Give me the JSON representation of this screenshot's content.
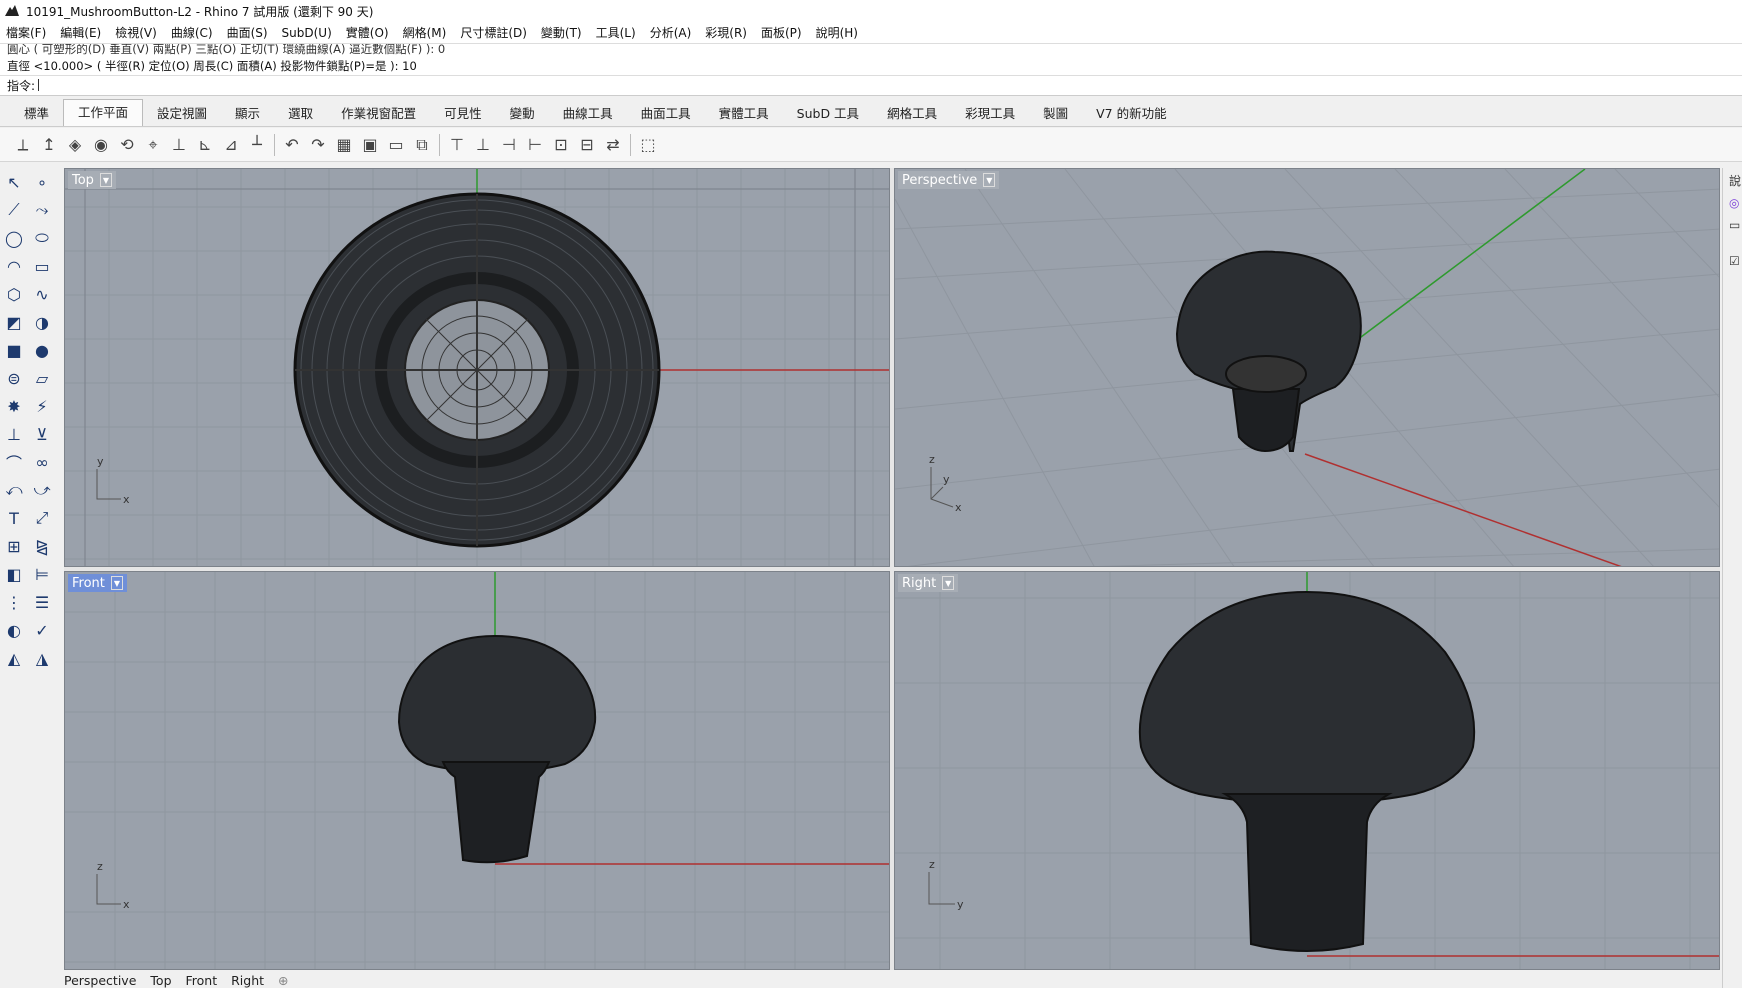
{
  "window": {
    "title": "10191_MushroomButton-L2 - Rhino 7 試用版 (還剩下 90 天)"
  },
  "menu": [
    "檔案(F)",
    "編輯(E)",
    "檢視(V)",
    "曲線(C)",
    "曲面(S)",
    "SubD(U)",
    "實體(O)",
    "網格(M)",
    "尺寸標註(D)",
    "變動(T)",
    "工具(L)",
    "分析(A)",
    "彩現(R)",
    "面板(P)",
    "說明(H)"
  ],
  "command": {
    "history_1": "圓心 ( 可塑形的(D) 垂直(V) 兩點(P) 三點(O) 正切(T) 環繞曲線(A) 逼近數個點(F) ): 0",
    "history_2": "直徑 <10.000> ( 半徑(R) 定位(O) 周長(C) 面積(A) 投影物件鎖點(P)=是 ): 10",
    "prompt": "指令:"
  },
  "tabs": [
    "標準",
    "工作平面",
    "設定視圖",
    "顯示",
    "選取",
    "作業視窗配置",
    "可見性",
    "變動",
    "曲線工具",
    "曲面工具",
    "實體工具",
    "SubD 工具",
    "網格工具",
    "彩現工具",
    "製圖",
    "V7 的新功能"
  ],
  "active_tab": "工作平面",
  "viewports": {
    "top": {
      "label": "Top",
      "axis_a": "y",
      "axis_b": "x"
    },
    "perspective": {
      "label": "Perspective",
      "axis_a": "z",
      "axis_b": "y",
      "axis_c": "x"
    },
    "front": {
      "label": "Front",
      "axis_a": "z",
      "axis_b": "x"
    },
    "right": {
      "label": "Right",
      "axis_a": "z",
      "axis_b": "y"
    }
  },
  "bottom_tabs": [
    "Perspective",
    "Top",
    "Front",
    "Right"
  ],
  "colors": {
    "viewport_bg": "#9aa1ab",
    "grid_minor": "#8f969f",
    "grid_major": "#7f868f",
    "x_axis": "#b03030",
    "y_axis": "#2e9a2e",
    "active_label": "#6f8fd8"
  }
}
